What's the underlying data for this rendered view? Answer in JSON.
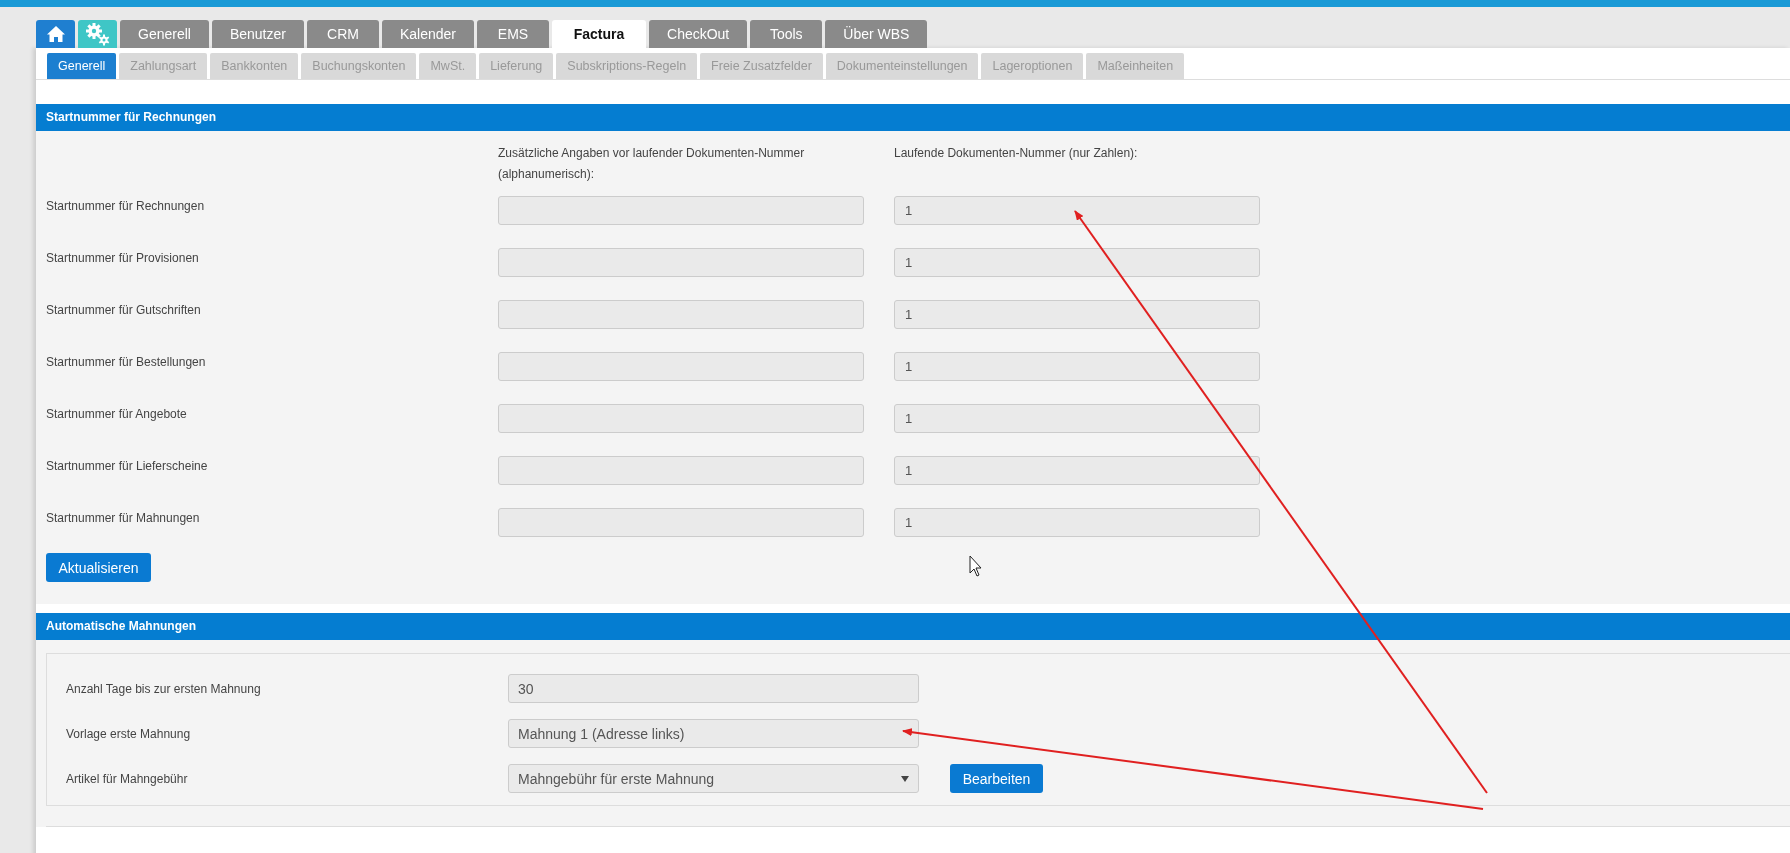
{
  "main_tabs": [
    {
      "kind": "home",
      "selected": false
    },
    {
      "kind": "gear",
      "selected": false
    },
    {
      "kind": "text",
      "label": "Generell",
      "selected": false
    },
    {
      "kind": "text",
      "label": "Benutzer",
      "selected": false
    },
    {
      "kind": "text",
      "label": "CRM",
      "selected": false
    },
    {
      "kind": "text",
      "label": "Kalender",
      "selected": false
    },
    {
      "kind": "text",
      "label": "EMS",
      "selected": false
    },
    {
      "kind": "text",
      "label": "Factura",
      "selected": true
    },
    {
      "kind": "text",
      "label": "CheckOut",
      "selected": false
    },
    {
      "kind": "text",
      "label": "Tools",
      "selected": false
    },
    {
      "kind": "text",
      "label": "Über WBS",
      "selected": false
    }
  ],
  "sub_tabs": [
    {
      "label": "Generell",
      "selected": true
    },
    {
      "label": "Zahlungsart",
      "selected": false
    },
    {
      "label": "Bankkonten",
      "selected": false
    },
    {
      "label": "Buchungskonten",
      "selected": false
    },
    {
      "label": "MwSt.",
      "selected": false
    },
    {
      "label": "Lieferung",
      "selected": false
    },
    {
      "label": "Subskriptions-Regeln",
      "selected": false
    },
    {
      "label": "Freie Zusatzfelder",
      "selected": false
    },
    {
      "label": "Dokumenteinstellungen",
      "selected": false
    },
    {
      "label": "Lageroptionen",
      "selected": false
    },
    {
      "label": "Maßeinheiten",
      "selected": false
    }
  ],
  "start_numbers": {
    "title": "Startnummer für Rechnungen",
    "columns": [
      "Zusätzliche Angaben vor laufender Dokumenten-Nummer (alphanumerisch):",
      "Laufende Dokumenten-Nummer (nur Zahlen):"
    ],
    "rows": [
      {
        "label": "Startnummer für Rechnungen",
        "prefix": "",
        "number": "1"
      },
      {
        "label": "Startnummer für Provisionen",
        "prefix": "",
        "number": "1"
      },
      {
        "label": "Startnummer für Gutschriften",
        "prefix": "",
        "number": "1"
      },
      {
        "label": "Startnummer für Bestellungen",
        "prefix": "",
        "number": "1"
      },
      {
        "label": "Startnummer für Angebote",
        "prefix": "",
        "number": "1"
      },
      {
        "label": "Startnummer für Lieferscheine",
        "prefix": "",
        "number": "1"
      },
      {
        "label": "Startnummer für Mahnungen",
        "prefix": "",
        "number": "1"
      }
    ],
    "button": "Aktualisieren"
  },
  "reminders": {
    "title": "Automatische Mahnungen",
    "rows": [
      {
        "kind": "input",
        "label": "Anzahl Tage bis zur ersten Mahnung",
        "value": "30"
      },
      {
        "kind": "input",
        "label": "Vorlage erste Mahnung",
        "value": "Mahnung 1 (Adresse links)"
      },
      {
        "kind": "select",
        "label": "Artikel für Mahngebühr",
        "value": "Mahngebühr für erste Mahnung",
        "button": "Bearbeiten"
      }
    ]
  }
}
